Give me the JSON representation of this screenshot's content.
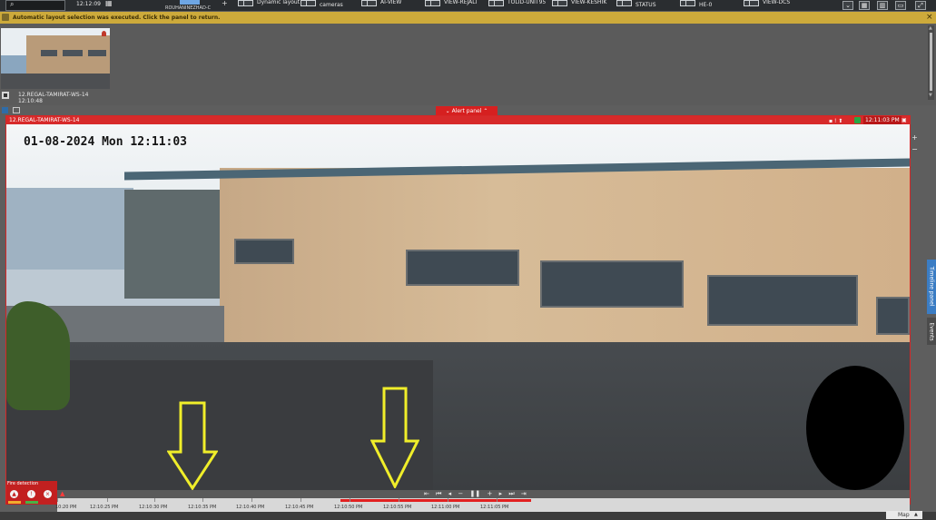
{
  "topbar": {
    "clock": "12:12:09",
    "user_label": "ROUHANINEZHAD-C",
    "layouts": [
      {
        "label": "Dynamic layout"
      },
      {
        "label": "cameras"
      },
      {
        "label": "AI-VIEW"
      },
      {
        "label": "VIEW-REJALI"
      },
      {
        "label": "TOLID-UNIT95"
      },
      {
        "label": "VIEW-KESHIK"
      },
      {
        "label": "STATUS"
      },
      {
        "label": "HE-0"
      },
      {
        "label": "VIEW-DCS"
      }
    ]
  },
  "infobar": {
    "message": "Automatic layout selection was executed. Click the panel to return."
  },
  "thumbnail": {
    "title": "12.REGAL-TAMIRAT-WS-14",
    "time": "12:10:48"
  },
  "alert_panel": {
    "label": "Alert panel"
  },
  "camera": {
    "name": "12.REGAL-TAMIRAT-WS-14",
    "clock": "12:11:03 PM",
    "osd_timestamp": "01-08-2024 Mon 12:11:03"
  },
  "fire": {
    "label": "Fire detection"
  },
  "side_tabs": {
    "timeline": "Timeline panel",
    "events": "Events"
  },
  "timeline": {
    "labels": [
      "10:20 PM",
      "12:10:25 PM",
      "12:10:30 PM",
      "12:10:35 PM",
      "12:10:40 PM",
      "12:10:45 PM",
      "12:10:50 PM",
      "12:10:55 PM",
      "12:11:00 PM",
      "12:11:05 PM"
    ]
  },
  "map_button": {
    "label": "Map"
  },
  "colors": {
    "alert_red": "#d62626",
    "info_yellow": "#cdaa3b",
    "annotation_arrow": "#f0ee2a"
  },
  "icons": [
    "search-icon",
    "grid-icon",
    "plus-icon",
    "close-icon",
    "bell-icon",
    "stop-icon",
    "play-icon",
    "pause-icon",
    "arrow-down-icon"
  ]
}
